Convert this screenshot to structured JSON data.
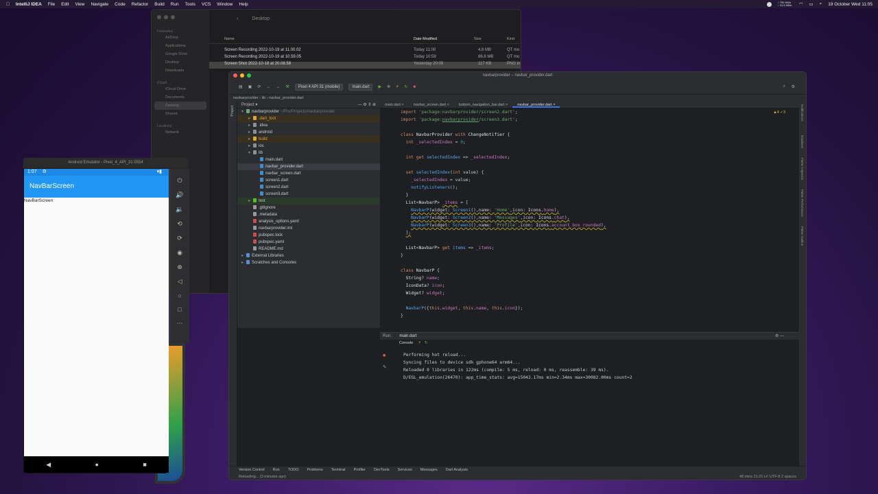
{
  "menubar": {
    "apple": "",
    "items": [
      "IntelliJ IDEA",
      "File",
      "Edit",
      "View",
      "Navigate",
      "Code",
      "Refactor",
      "Build",
      "Run",
      "Tools",
      "VCS",
      "Window",
      "Help"
    ],
    "net": "↑ 790 KB/s ↓ 21,5 KB/s",
    "datetime": "19 October Wed 11:05"
  },
  "finder": {
    "title": "Desktop",
    "sidebar": {
      "favourites_header": "Favourites",
      "favourites": [
        "AirDrop",
        "Applications",
        "Google Drive",
        "Desktop",
        "Downloads"
      ],
      "icloud_header": "iCloud",
      "icloud": [
        "iCloud Drive",
        "Documents",
        "Desktop",
        "Shared"
      ],
      "locations_header": "Locations",
      "locations": [
        "Network"
      ]
    },
    "columns": {
      "name": "Name",
      "date": "Date Modified",
      "size": "Size",
      "kind": "Kind"
    },
    "rows": [
      {
        "name": "Screen Recording 2022-10-19 at 11.00.02",
        "date": "Today 11:00",
        "size": "4,6 MB",
        "kind": "QT mo"
      },
      {
        "name": "Screen Recording 2022-10-19 at 10.59.05",
        "date": "Today 10:59",
        "size": "86,6 MB",
        "kind": "QT mo"
      },
      {
        "name": "Screen Shot 2022-10-18 at 20.08.58",
        "date": "Yesterday 20:09",
        "size": "117 KB",
        "kind": "PNG in"
      }
    ]
  },
  "emulator": {
    "title": "Android Emulator - Pixel_4_API_31:5554",
    "time": "1:07",
    "app_title": "NavBarScreen",
    "body_text": "NavBarScreen",
    "controls": [
      "power-icon",
      "volume-up-icon",
      "volume-down-icon",
      "rotate-left-icon",
      "rotate-right-icon",
      "camera-icon",
      "zoom-icon",
      "back-icon",
      "home-icon",
      "overview-icon",
      "more-icon"
    ],
    "nav": [
      "◀",
      "●",
      "■"
    ]
  },
  "ide": {
    "title": "navbarprovider – navbar_provider.dart",
    "device": "Pixel 4 API 31 (mobile)",
    "run_config": "main.dart",
    "breadcrumb": [
      "navbarprovider",
      "lib",
      "navbar_provider.dart"
    ],
    "project_label": "Project",
    "tree": [
      {
        "label": "navbarprovider",
        "hint": "~/Pro/Projects/navbarprovider",
        "indent": 0,
        "kind": "module",
        "arrow": "▾"
      },
      {
        "label": ".dart_tool",
        "indent": 1,
        "kind": "excluded",
        "arrow": "▸"
      },
      {
        "label": ".idea",
        "indent": 1,
        "kind": "folder",
        "arrow": "▸"
      },
      {
        "label": "android",
        "indent": 1,
        "kind": "folder",
        "arrow": "▸"
      },
      {
        "label": "build",
        "indent": 1,
        "kind": "excluded",
        "arrow": "▸"
      },
      {
        "label": "ios",
        "indent": 1,
        "kind": "folder",
        "arrow": "▸"
      },
      {
        "label": "lib",
        "indent": 1,
        "kind": "folder",
        "arrow": "▾"
      },
      {
        "label": "main.dart",
        "indent": 2,
        "kind": "dart"
      },
      {
        "label": "navbar_provider.dart",
        "indent": 2,
        "kind": "dart",
        "selected": true
      },
      {
        "label": "navbar_screen.dart",
        "indent": 2,
        "kind": "dart"
      },
      {
        "label": "screen1.dart",
        "indent": 2,
        "kind": "dart"
      },
      {
        "label": "screen2.dart",
        "indent": 2,
        "kind": "dart"
      },
      {
        "label": "screen3.dart",
        "indent": 2,
        "kind": "dart"
      },
      {
        "label": "test",
        "indent": 1,
        "kind": "test",
        "arrow": "▸"
      },
      {
        "label": ".gitignore",
        "indent": 1,
        "kind": "file"
      },
      {
        "label": ".metadata",
        "indent": 1,
        "kind": "file"
      },
      {
        "label": "analysis_options.yaml",
        "indent": 1,
        "kind": "yaml"
      },
      {
        "label": "navbarprovider.iml",
        "indent": 1,
        "kind": "file"
      },
      {
        "label": "pubspec.lock",
        "indent": 1,
        "kind": "yaml"
      },
      {
        "label": "pubspec.yaml",
        "indent": 1,
        "kind": "yaml"
      },
      {
        "label": "README.md",
        "indent": 1,
        "kind": "file"
      },
      {
        "label": "External Libraries",
        "indent": 0,
        "kind": "lib",
        "arrow": "▸"
      },
      {
        "label": "Scratches and Consoles",
        "indent": 0,
        "kind": "lib",
        "arrow": "▸"
      }
    ],
    "tabs": [
      "main.dart",
      "navbar_screen.dart",
      "bottom_navigation_bar.dart",
      "navbar_provider.dart"
    ],
    "active_tab": 3,
    "inspections": "▲4  ✓3",
    "run": {
      "label": "Run:",
      "config": "main.dart",
      "console": "Console",
      "output": [
        "Performing hot reload...",
        "Syncing files to device sdk gphone64 arm64...",
        "Reloaded 0 libraries in 122ms (compile: 5 ms, reload: 0 ms, reassemble: 39 ms).",
        "D/EGL_emulation(26470): app_time_stats: avg=15042.17ms min=2.34ms max=30082.00ms count=2"
      ]
    },
    "bottom_tools": [
      "Version Control",
      "Run",
      "TODO",
      "Problems",
      "Terminal",
      "Profiler",
      "DevTools",
      "Services",
      "Messages",
      "Dart Analysis"
    ],
    "status_left": "Reloading... (3 minutes ago)",
    "status_right": "48 mins  21:21  LF  UTF-8  2 spaces"
  }
}
